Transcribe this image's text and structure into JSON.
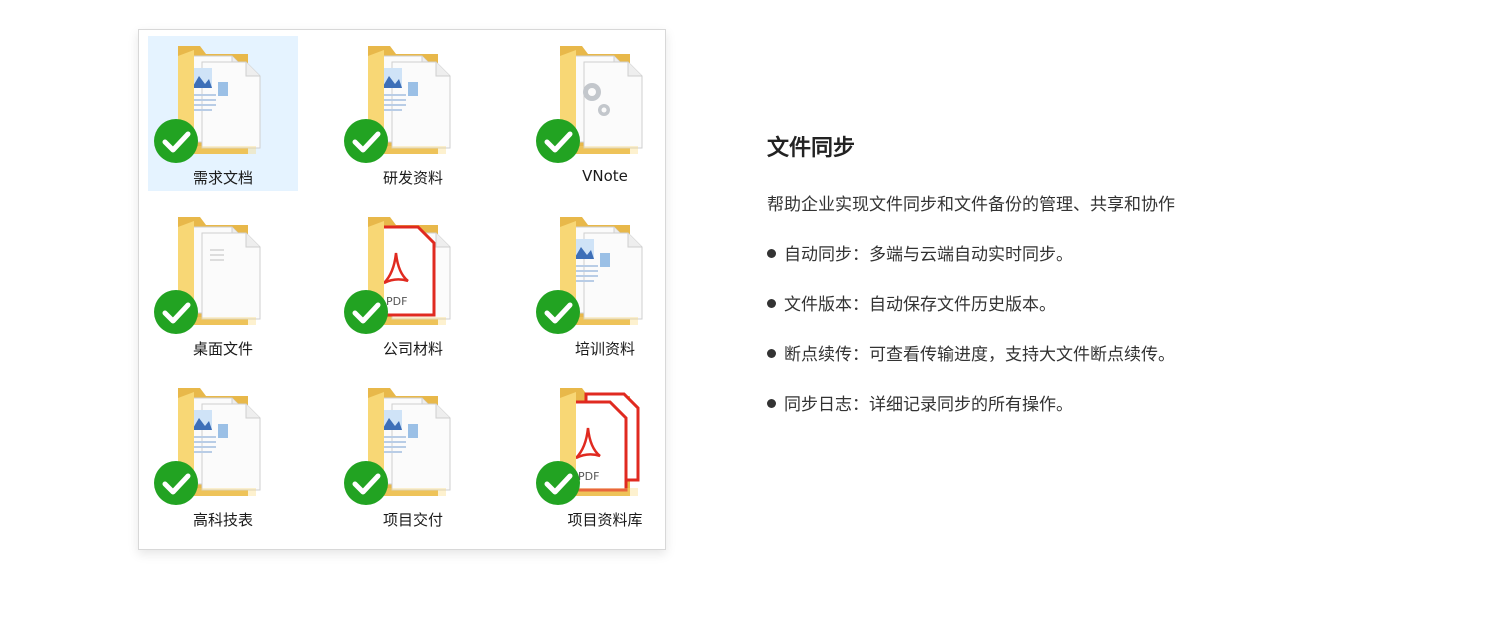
{
  "folders": [
    {
      "label": "需求文档",
      "thumb": "image-doc",
      "selected": true
    },
    {
      "label": "研发资料",
      "thumb": "image-doc",
      "selected": false
    },
    {
      "label": "VNote",
      "thumb": "gear-doc",
      "selected": false
    },
    {
      "label": "桌面文件",
      "thumb": "plain-doc",
      "selected": false
    },
    {
      "label": "公司材料",
      "thumb": "pdf-doc",
      "selected": false
    },
    {
      "label": "培训资料",
      "thumb": "image-doc",
      "selected": false
    },
    {
      "label": "高科技表",
      "thumb": "image-doc",
      "selected": false
    },
    {
      "label": "项目交付",
      "thumb": "image-doc",
      "selected": false
    },
    {
      "label": "项目资料库",
      "thumb": "pdf-double",
      "selected": false
    }
  ],
  "pdf_text": "PDF",
  "feature": {
    "title": "文件同步",
    "description": "帮助企业实现文件同步和文件备份的管理、共享和协作",
    "bullets": [
      "自动同步：多端与云端自动实时同步。",
      "文件版本：自动保存文件历史版本。",
      "断点续传：可查看传输进度，支持大文件断点续传。",
      "同步日志：详细记录同步的所有操作。"
    ]
  },
  "colors": {
    "folder": "#f8d775",
    "folder_dark": "#e8b84a",
    "check": "#22a322",
    "selection": "#e5f3ff",
    "pdf_red": "#e02a20"
  }
}
